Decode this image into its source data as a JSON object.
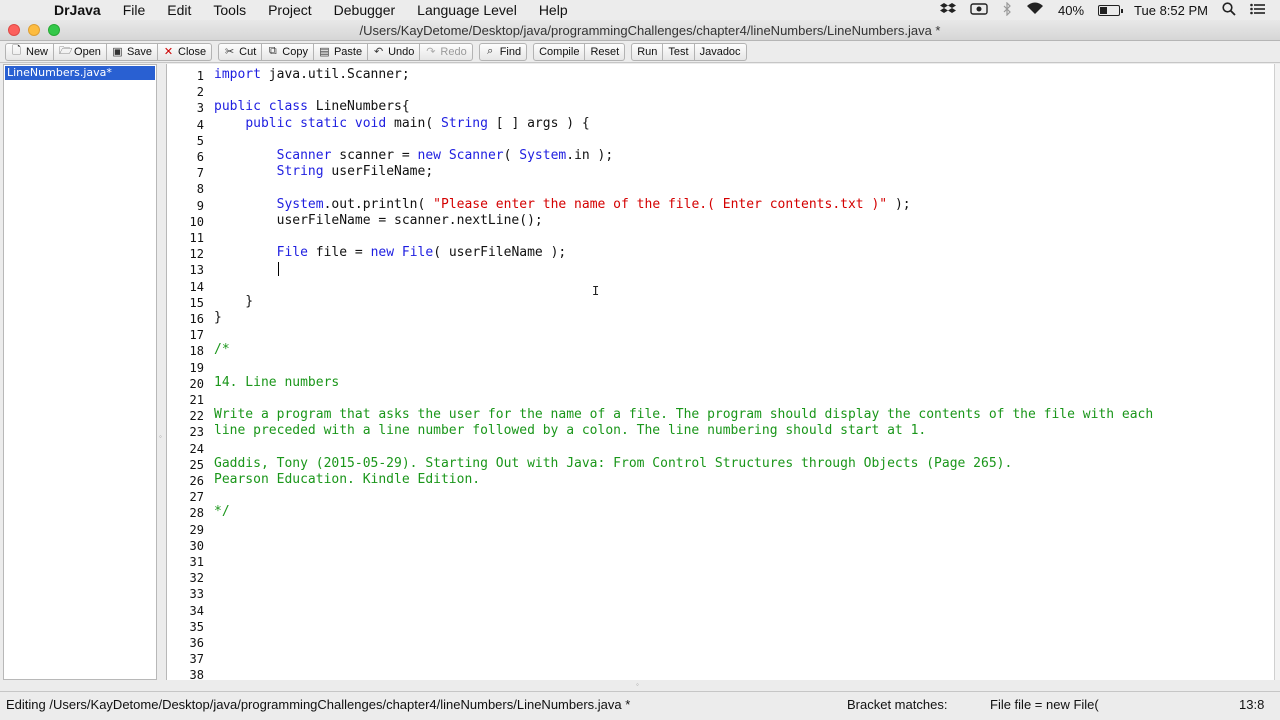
{
  "menubar": {
    "apple_glyph": "",
    "app_name": "DrJava",
    "items": [
      "File",
      "Edit",
      "Tools",
      "Project",
      "Debugger",
      "Language Level",
      "Help"
    ],
    "battery_percent": "40%",
    "battery_level": 0.4,
    "clock": "Tue 8:52 PM"
  },
  "window": {
    "title": "/Users/KayDetome/Desktop/java/programmingChallenges/chapter4/lineNumbers/LineNumbers.java *"
  },
  "toolbar": {
    "new": "New",
    "open": "Open",
    "save": "Save",
    "close": "Close",
    "cut": "Cut",
    "copy": "Copy",
    "paste": "Paste",
    "undo": "Undo",
    "redo": "Redo",
    "find": "Find",
    "compile": "Compile",
    "reset": "Reset",
    "run": "Run",
    "test": "Test",
    "javadoc": "Javadoc"
  },
  "documents": [
    {
      "name": "LineNumbers.java*",
      "selected": true
    }
  ],
  "editor": {
    "lines": [
      [
        {
          "t": "import",
          "c": "key"
        },
        {
          "t": " java.util.Scanner;",
          "c": "plain"
        }
      ],
      [],
      [
        {
          "t": "public class",
          "c": "key"
        },
        {
          "t": " LineNumbers{",
          "c": "plain"
        }
      ],
      [
        {
          "t": "    ",
          "c": "plain"
        },
        {
          "t": "public static void",
          "c": "key"
        },
        {
          "t": " main( ",
          "c": "plain"
        },
        {
          "t": "String",
          "c": "key"
        },
        {
          "t": " [ ] args ) {",
          "c": "plain"
        }
      ],
      [],
      [
        {
          "t": "        ",
          "c": "plain"
        },
        {
          "t": "Scanner",
          "c": "key"
        },
        {
          "t": " scanner = ",
          "c": "plain"
        },
        {
          "t": "new",
          "c": "key"
        },
        {
          "t": " ",
          "c": "plain"
        },
        {
          "t": "Scanner",
          "c": "key"
        },
        {
          "t": "( ",
          "c": "plain"
        },
        {
          "t": "System",
          "c": "key"
        },
        {
          "t": ".in );",
          "c": "plain"
        }
      ],
      [
        {
          "t": "        ",
          "c": "plain"
        },
        {
          "t": "String",
          "c": "key"
        },
        {
          "t": " userFileName;",
          "c": "plain"
        }
      ],
      [],
      [
        {
          "t": "        ",
          "c": "plain"
        },
        {
          "t": "System",
          "c": "key"
        },
        {
          "t": ".out.println( ",
          "c": "plain"
        },
        {
          "t": "\"Please enter the name of the file.( Enter contents.txt )\"",
          "c": "str"
        },
        {
          "t": " );",
          "c": "plain"
        }
      ],
      [
        {
          "t": "        userFileName = scanner.nextLine();",
          "c": "plain"
        }
      ],
      [],
      [
        {
          "t": "        ",
          "c": "plain"
        },
        {
          "t": "File",
          "c": "key"
        },
        {
          "t": " file = ",
          "c": "plain"
        },
        {
          "t": "new",
          "c": "key"
        },
        {
          "t": " ",
          "c": "plain"
        },
        {
          "t": "File",
          "c": "key"
        },
        {
          "t": "( userFileName );",
          "c": "plain"
        }
      ],
      [],
      [],
      [
        {
          "t": "    }",
          "c": "plain"
        }
      ],
      [
        {
          "t": "}",
          "c": "plain"
        }
      ],
      [],
      [
        {
          "t": "/*",
          "c": "com"
        }
      ],
      [],
      [
        {
          "t": "14. Line numbers",
          "c": "com"
        }
      ],
      [],
      [
        {
          "t": "Write a program that asks the user for the name of a file. The program should display the contents of the file with each",
          "c": "com"
        }
      ],
      [
        {
          "t": "line preceded with a line number followed by a colon. The line numbering should start at 1.",
          "c": "com"
        }
      ],
      [],
      [
        {
          "t": "Gaddis, Tony (2015-05-29). Starting Out with Java: From Control Structures through Objects (Page 265).",
          "c": "com"
        }
      ],
      [
        {
          "t": "Pearson Education. Kindle Edition.",
          "c": "com"
        }
      ],
      [],
      [
        {
          "t": "*/",
          "c": "com"
        }
      ],
      [],
      [],
      [],
      [],
      [],
      [],
      [],
      [],
      [],
      []
    ],
    "caret_line": 13,
    "caret_col": 8
  },
  "colors": {
    "keyword": "#1e1ee0",
    "string": "#d40000",
    "comment": "#1a961a",
    "selection": "#2960d2"
  },
  "statusbar": {
    "editing": "Editing /Users/KayDetome/Desktop/java/programmingChallenges/chapter4/lineNumbers/LineNumbers.java *",
    "bracket_label": "Bracket matches:",
    "bracket_value": "File file = new File(",
    "position": "13:8"
  }
}
